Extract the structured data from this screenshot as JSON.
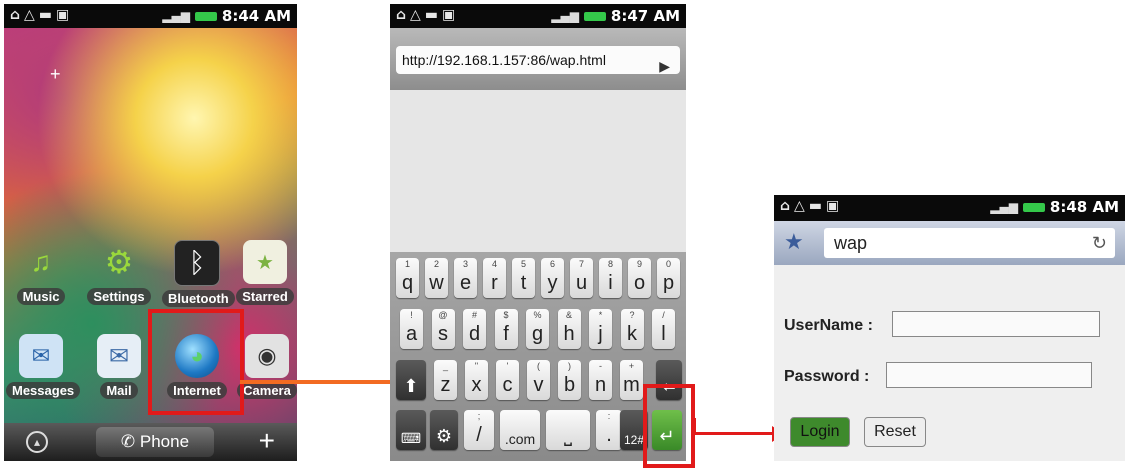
{
  "screen1": {
    "time": "8:44 AM",
    "apps": [
      {
        "label": "Music",
        "icon": "music-note-icon"
      },
      {
        "label": "Settings",
        "icon": "gear-icon"
      },
      {
        "label": "Bluetooth",
        "icon": "bluetooth-icon"
      },
      {
        "label": "Starred",
        "icon": "folder-star-icon"
      },
      {
        "label": "Messages",
        "icon": "messages-icon"
      },
      {
        "label": "Mail",
        "icon": "mail-icon"
      },
      {
        "label": "Internet",
        "icon": "globe-icon"
      },
      {
        "label": "Camera",
        "icon": "camera-icon"
      }
    ],
    "dock": {
      "phone_label": "Phone"
    }
  },
  "screen2": {
    "time": "8:47 AM",
    "url": "http://192.168.1.157:86/wap.html",
    "keyboard": {
      "row1": [
        [
          "1",
          "q"
        ],
        [
          "2",
          "w"
        ],
        [
          "3",
          "e"
        ],
        [
          "4",
          "r"
        ],
        [
          "5",
          "t"
        ],
        [
          "6",
          "y"
        ],
        [
          "7",
          "u"
        ],
        [
          "8",
          "i"
        ],
        [
          "9",
          "o"
        ],
        [
          "0",
          "p"
        ]
      ],
      "row2": [
        [
          "!",
          "a"
        ],
        [
          "@",
          "s"
        ],
        [
          "#",
          "d"
        ],
        [
          "$",
          "f"
        ],
        [
          "%",
          "g"
        ],
        [
          "&",
          "h"
        ],
        [
          "*",
          "j"
        ],
        [
          "?",
          "k"
        ],
        [
          "/",
          "l"
        ]
      ],
      "row3": [
        [
          "_",
          "z"
        ],
        [
          "\"",
          "x"
        ],
        [
          "'",
          "c"
        ],
        [
          "(",
          "v"
        ],
        [
          ")",
          "b"
        ],
        [
          "-",
          "n"
        ],
        [
          "+",
          "m"
        ]
      ],
      "com": ".com",
      "sym": "12#"
    }
  },
  "screen3": {
    "time": "8:48 AM",
    "url": "wap",
    "username_label": "UserName :",
    "password_label": "Password :",
    "login_label": "Login",
    "reset_label": "Reset"
  },
  "colors": {
    "highlight": "#e11a1a",
    "arrow": "#f26b22",
    "login_button": "#3e8a2c"
  }
}
